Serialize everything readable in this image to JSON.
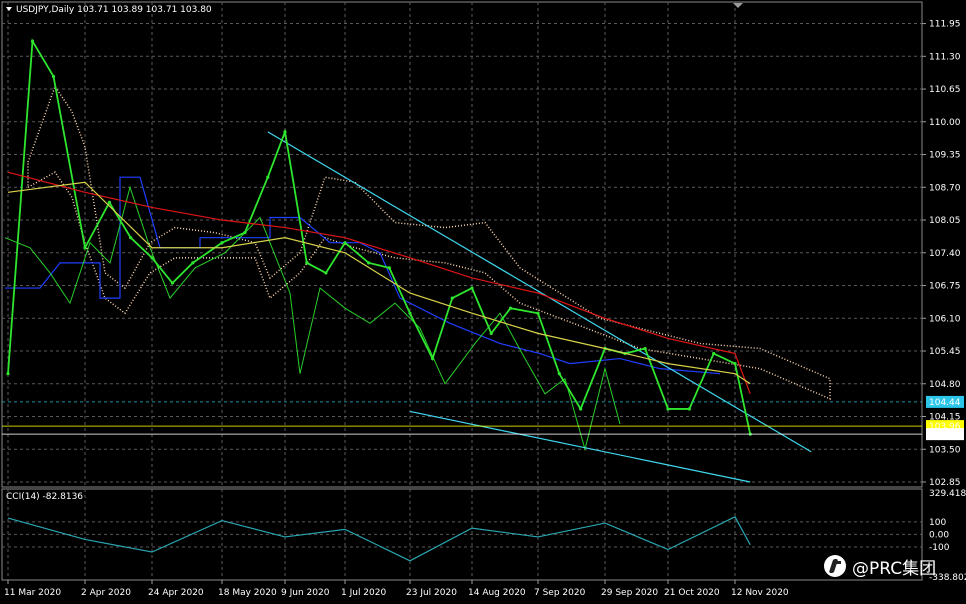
{
  "header": {
    "symbol_line": "USDJPY,Daily  103.71 103.89 103.71 103.80",
    "cci_label": "CCI(14) -82.8136"
  },
  "watermark": {
    "text": "@PRC集团",
    "icon": "prc-logo-icon"
  },
  "colors": {
    "background": "#000000",
    "grid": "#5a5a5a",
    "price": "#2ee62e",
    "ma_red": "#e01515",
    "ma_yellow": "#d8d24a",
    "kijun_blue": "#1f3fff",
    "cloud": "#ffd6b0",
    "trendline": "#40d8f0",
    "cci_line": "#2aa6b2",
    "axis_text": "#ffffff",
    "tag_yellow": "#ffff00",
    "tag_cyan": "#00ffff"
  },
  "chart_data": [
    {
      "type": "line",
      "title": "USDJPY,Daily",
      "ohlc_last": {
        "open": 103.71,
        "high": 103.89,
        "low": 103.71,
        "close": 103.8
      },
      "ylim": [
        102.85,
        112.1
      ],
      "y_ticks": [
        "111.95",
        "111.30",
        "110.65",
        "110.00",
        "109.35",
        "108.70",
        "108.05",
        "107.40",
        "106.75",
        "106.10",
        "105.45",
        "104.80",
        "104.15",
        "103.50",
        "102.85"
      ],
      "x_ticks": [
        "11 Mar 2020",
        "2 Apr 2020",
        "24 Apr 2020",
        "18 May 2020",
        "9 Jun 2020",
        "1 Jul 2020",
        "23 Jul 2020",
        "14 Aug 2020",
        "7 Sep 2020",
        "29 Sep 2020",
        "21 Oct 2020",
        "12 Nov 2020"
      ],
      "price_tags": [
        {
          "label": "104.44",
          "value": 104.44,
          "style": "cyan"
        },
        {
          "label": "103.96",
          "value": 103.96,
          "style": "yellow"
        },
        {
          "label": "103.80",
          "value": 103.8,
          "style": "white"
        }
      ],
      "series": [
        {
          "role": "price",
          "x": [
            "11 Mar 2020",
            "18 Mar 2020",
            "24 Mar 2020",
            "2 Apr 2020",
            "10 Apr 2020",
            "17 Apr 2020",
            "24 Apr 2020",
            "1 May 2020",
            "8 May 2020",
            "18 May 2020",
            "26 May 2020",
            "3 Jun 2020",
            "9 Jun 2020",
            "17 Jun 2020",
            "24 Jun 2020",
            "1 Jul 2020",
            "9 Jul 2020",
            "16 Jul 2020",
            "23 Jul 2020",
            "31 Jul 2020",
            "7 Aug 2020",
            "14 Aug 2020",
            "21 Aug 2020",
            "28 Aug 2020",
            "7 Sep 2020",
            "14 Sep 2020",
            "21 Sep 2020",
            "29 Sep 2020",
            "6 Oct 2020",
            "13 Oct 2020",
            "21 Oct 2020",
            "28 Oct 2020",
            "5 Nov 2020",
            "12 Nov 2020",
            "17 Nov 2020"
          ],
          "values": [
            105.0,
            111.6,
            110.9,
            107.5,
            108.4,
            107.7,
            107.3,
            106.8,
            107.2,
            107.6,
            107.8,
            108.9,
            109.8,
            107.2,
            107.0,
            107.6,
            107.2,
            107.1,
            106.2,
            105.3,
            106.5,
            106.7,
            105.8,
            106.3,
            106.2,
            105.0,
            104.3,
            105.5,
            105.4,
            105.5,
            104.3,
            104.3,
            105.4,
            105.2,
            103.8
          ]
        },
        {
          "role": "moving-average-slow",
          "x": [
            "11 Mar 2020",
            "2 Apr 2020",
            "24 Apr 2020",
            "18 May 2020",
            "9 Jun 2020",
            "1 Jul 2020",
            "23 Jul 2020",
            "14 Aug 2020",
            "7 Sep 2020",
            "29 Sep 2020",
            "21 Oct 2020",
            "12 Nov 2020",
            "17 Nov 2020"
          ],
          "values": [
            109.0,
            108.6,
            108.3,
            108.05,
            107.9,
            107.7,
            107.3,
            106.9,
            106.6,
            106.1,
            105.7,
            105.4,
            104.6
          ]
        },
        {
          "role": "moving-average-fast",
          "x": [
            "11 Mar 2020",
            "2 Apr 2020",
            "24 Apr 2020",
            "18 May 2020",
            "9 Jun 2020",
            "1 Jul 2020",
            "23 Jul 2020",
            "14 Aug 2020",
            "7 Sep 2020",
            "29 Sep 2020",
            "21 Oct 2020",
            "12 Nov 2020",
            "17 Nov 2020"
          ],
          "values": [
            108.6,
            108.8,
            107.5,
            107.5,
            107.7,
            107.4,
            106.6,
            106.2,
            105.8,
            105.5,
            105.2,
            105.0,
            104.8
          ]
        }
      ],
      "trendlines": [
        {
          "from": {
            "x": "3 Jun 2020",
            "y": 109.8
          },
          "to": {
            "x": "7 Dec 2020",
            "y": 103.45
          }
        },
        {
          "from": {
            "x": "23 Jul 2020",
            "y": 104.25
          },
          "to": {
            "x": "17 Nov 2020",
            "y": 102.85
          }
        }
      ]
    },
    {
      "type": "line",
      "title": "CCI(14) -82.8136",
      "ylim": [
        -338.802,
        329.4185
      ],
      "y_ticks": [
        "329.4185",
        "100",
        "0.00",
        "-100",
        "-338.802"
      ],
      "series": [
        {
          "role": "cci",
          "x": [
            "11 Mar 2020",
            "2 Apr 2020",
            "24 Apr 2020",
            "18 May 2020",
            "9 Jun 2020",
            "1 Jul 2020",
            "23 Jul 2020",
            "14 Aug 2020",
            "7 Sep 2020",
            "29 Sep 2020",
            "21 Oct 2020",
            "12 Nov 2020",
            "17 Nov 2020"
          ],
          "values": [
            130,
            -40,
            -140,
            110,
            -20,
            40,
            -210,
            50,
            -20,
            90,
            -120,
            140,
            -82.81
          ]
        }
      ]
    }
  ]
}
